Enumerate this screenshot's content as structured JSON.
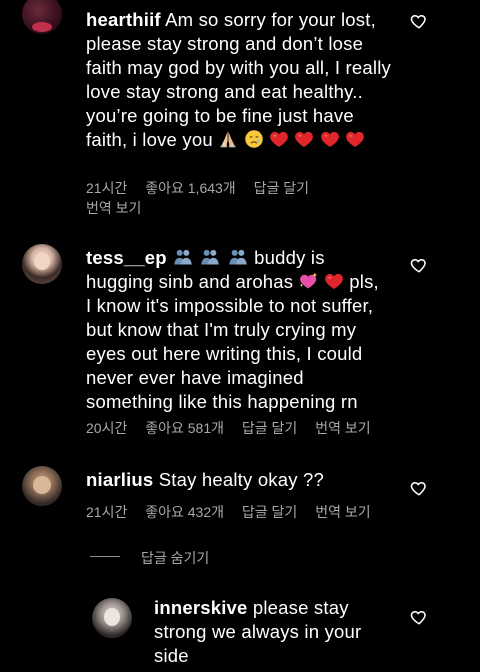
{
  "comments": [
    {
      "username": "hearthiif",
      "text": "Am so sorry for your lost, please stay strong and don’t lose faith may god by with you all, I really love stay strong and eat healthy.. you’re going to be fine just have faith, i love you",
      "time": "21시간",
      "likes": "좋아요 1,643개",
      "reply": "답글 달기",
      "translate": "번역 보기"
    },
    {
      "username": "tess__ep",
      "text_a": "buddy is hugging sinb and arohas",
      "text_b": "pls, I know it's impossible to not suffer, but know that I'm truly crying my eyes out here writing this, I could never ever have imagined something like this happening rn",
      "time": "20시간",
      "likes": "좋아요 581개",
      "reply": "답글 달기",
      "translate": "번역 보기"
    },
    {
      "username": "niarlius",
      "text": "Stay healty okay ??",
      "time": "21시간",
      "likes": "좋아요 432개",
      "reply": "답글 달기",
      "translate": "번역 보기",
      "hide_replies": "답글 숨기기"
    },
    {
      "username": "innerskive",
      "text": "please stay strong we always in your side"
    }
  ],
  "colors": {
    "background": "#000000",
    "text": "#ffffff",
    "meta": "#a8a8a8",
    "emoji_heart": "#e0252b"
  },
  "icons": [
    "heart-outline-icon",
    "praying-hands-emoji",
    "crying-face-emoji",
    "red-heart-emoji",
    "hugging-people-emoji",
    "sparkling-heart-emoji"
  ]
}
